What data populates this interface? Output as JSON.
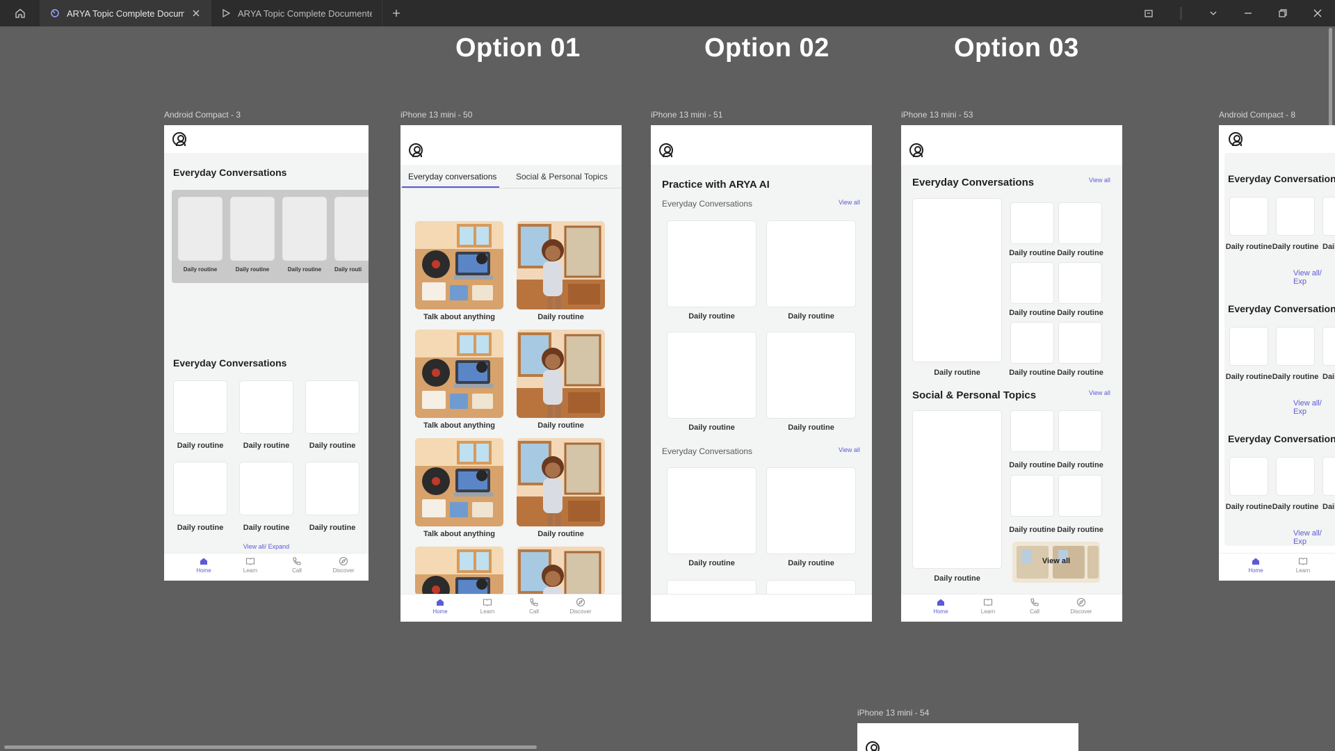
{
  "window": {
    "tabs": [
      {
        "label": "ARYA Topic Complete Document"
      },
      {
        "label": "ARYA Topic Complete Documented Fi"
      }
    ]
  },
  "options": [
    "Option 01",
    "Option 02",
    "Option 03"
  ],
  "frames": {
    "android3": {
      "label": "Android Compact - 3",
      "section1": "Everyday Conversations",
      "strip_labels": [
        "Daily routine",
        "Daily routine",
        "Daily routine",
        "Daily routi"
      ],
      "section2": "Everyday Conversations",
      "grid_labels": [
        "Daily routine",
        "Daily routine",
        "Daily routine",
        "Daily routine",
        "Daily routine",
        "Daily routine"
      ],
      "view_expand": "View all/ Expand"
    },
    "iphone50": {
      "label": "iPhone 13 mini - 50",
      "tabs": [
        "Everyday conversations",
        "Social & Personal Topics"
      ],
      "cards": [
        "Talk about anything",
        "Daily routine",
        "Talk about anything",
        "Daily routine",
        "Talk about anything",
        "Daily routine"
      ]
    },
    "iphone51": {
      "label": "iPhone 13 mini - 51",
      "heading": "Practice with ARYA AI",
      "sub1": "Everyday Conversations",
      "sub2": "Everyday Conversations",
      "view_all": "View all",
      "labels": [
        "Daily routine",
        "Daily routine",
        "Daily routine",
        "Daily routine",
        "Daily routine",
        "Daily routine"
      ]
    },
    "iphone53": {
      "label": "iPhone 13 mini - 53",
      "section1": "Everyday Conversations",
      "section2": "Social & Personal Topics",
      "view_all": "View all",
      "labels1": [
        "Daily routine",
        "Daily routine",
        "Daily routine",
        "Daily routine",
        "Daily routine",
        "Daily routine",
        "Daily routine"
      ],
      "labels2": [
        "Daily routine",
        "Daily routine",
        "Daily routine",
        "Daily routine",
        "Daily routine"
      ],
      "view_all_tile": "View all"
    },
    "android8": {
      "label": "Android Compact - 8",
      "sections": [
        "Everyday Conversations",
        "Everyday Conversations",
        "Everyday Conversations"
      ],
      "labels": [
        "Daily routine",
        "Daily routine",
        "Dail"
      ],
      "view_expand": "View all/ Exp"
    },
    "iphone54": {
      "label": "iPhone 13 mini - 54"
    }
  },
  "nav": {
    "home": "Home",
    "learn": "Learn",
    "call": "Call",
    "discover": "Discover"
  },
  "colors": {
    "accent": "#5b5bd6",
    "canvas": "#5f5f5f",
    "titlebar": "#2c2c2c"
  }
}
